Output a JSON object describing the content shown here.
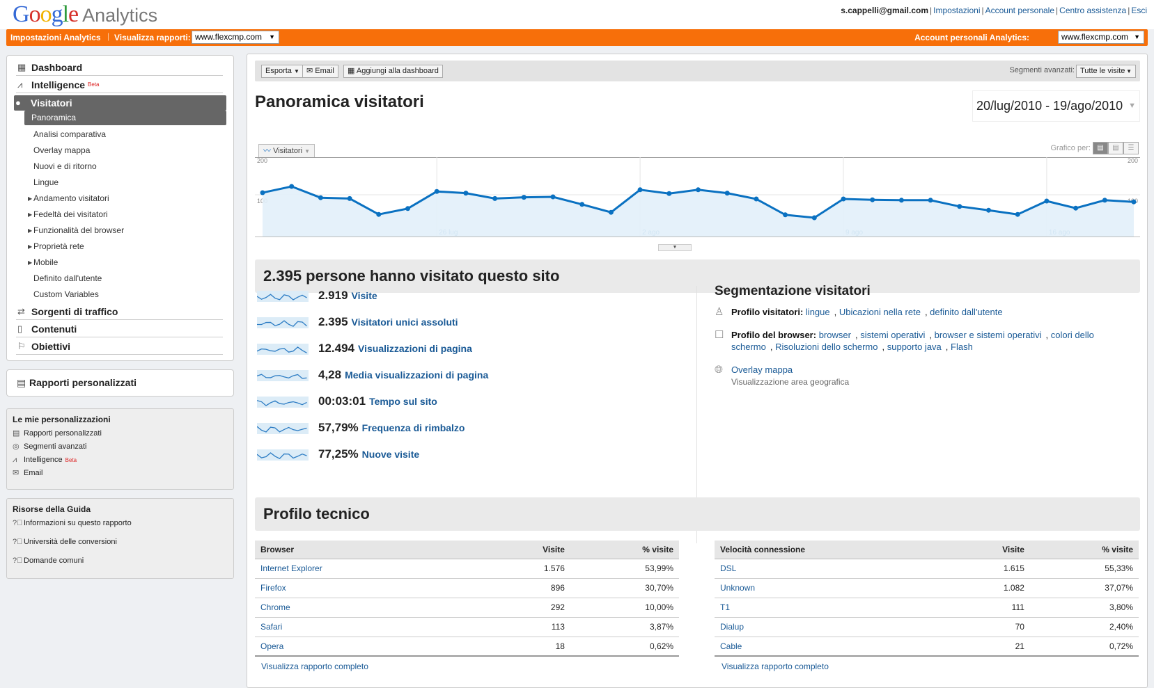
{
  "header": {
    "logo_google": "Google",
    "logo_product": "Analytics",
    "user": "s.cappelli@gmail.com",
    "links": [
      "Impostazioni",
      "Account personale",
      "Centro assistenza",
      "Esci"
    ]
  },
  "orangebar": {
    "settings": "Impostazioni Analytics",
    "view_reports_label": "Visualizza rapporti:",
    "view_reports_value": "www.flexcmp.com",
    "accounts_label": "Account personali Analytics:",
    "accounts_value": "www.flexcmp.com"
  },
  "sidebar": {
    "dashboard": "Dashboard",
    "intelligence": "Intelligence",
    "beta": "Beta",
    "visitors": "Visitatori",
    "sub": [
      {
        "label": "Panoramica",
        "active": true
      },
      {
        "label": "Analisi comparativa"
      },
      {
        "label": "Overlay mappa"
      },
      {
        "label": "Nuovi e di ritorno"
      },
      {
        "label": "Lingue"
      },
      {
        "label": "Andamento visitatori",
        "expand": true
      },
      {
        "label": "Fedeltà dei visitatori",
        "expand": true
      },
      {
        "label": "Funzionalità del browser",
        "expand": true
      },
      {
        "label": "Proprietà rete",
        "expand": true
      },
      {
        "label": "Mobile",
        "expand": true
      },
      {
        "label": "Definito dall'utente"
      },
      {
        "label": "Custom Variables"
      }
    ],
    "traffic": "Sorgenti di traffico",
    "content": "Contenuti",
    "goals": "Obiettivi",
    "custom_reports": "Rapporti personalizzati"
  },
  "personal": {
    "title": "Le mie personalizzazioni",
    "items": [
      "Rapporti personalizzati",
      "Segmenti avanzati",
      "Intelligence",
      "Email"
    ],
    "beta": "Beta"
  },
  "help": {
    "title": "Risorse della Guida",
    "items": [
      "Informazioni su questo rapporto",
      "Università delle conversioni",
      "Domande comuni"
    ]
  },
  "toolbar": {
    "export": "Esporta",
    "email": "Email",
    "add_dashboard": "Aggiungi alla dashboard",
    "segments_label": "Segmenti avanzati:",
    "segments_value": "Tutte le visite"
  },
  "page_title": "Panoramica visitatori",
  "date_range": "20/lug/2010 - 19/ago/2010",
  "chart_tab": "Visitatori",
  "graph_by": "Grafico per:",
  "chart_data": {
    "type": "area",
    "series": [
      {
        "name": "Visitatori",
        "values": [
          105,
          120,
          93,
          91,
          53,
          67,
          108,
          104,
          91,
          94,
          95,
          77,
          58,
          112,
          103,
          112,
          104,
          90,
          52,
          45,
          90,
          88,
          87,
          87,
          72,
          63,
          53,
          85,
          68,
          87,
          83
        ]
      }
    ],
    "ylim": [
      0,
      200
    ],
    "yticks_left": [
      "200",
      "100"
    ],
    "yticks_right": [
      "200",
      "100"
    ],
    "xtick_labels": [
      "26 lug",
      "2 ago",
      "9 ago",
      "16 ago"
    ],
    "xtick_index": [
      6,
      13,
      20,
      27
    ],
    "color": "#0a71c1",
    "fill": "#e2f0f9",
    "grid": true
  },
  "summary": "2.395 persone hanno visitato questo sito",
  "metrics": [
    {
      "value": "2.919",
      "label": "Visite"
    },
    {
      "value": "2.395",
      "label": "Visitatori unici assoluti"
    },
    {
      "value": "12.494",
      "label": "Visualizzazioni di pagina"
    },
    {
      "value": "4,28",
      "label": "Media visualizzazioni di pagina"
    },
    {
      "value": "00:03:01",
      "label": "Tempo sul sito"
    },
    {
      "value": "57,79%",
      "label": "Frequenza di rimbalzo"
    },
    {
      "value": "77,25%",
      "label": "Nuove visite"
    }
  ],
  "segmentation": {
    "title": "Segmentazione visitatori",
    "visitor_profile": "Profilo visitatori:",
    "visitor_links": [
      "lingue",
      "Ubicazioni nella rete",
      "definito dall'utente"
    ],
    "browser_profile": "Profilo del browser:",
    "browser_links": [
      "browser",
      "sistemi operativi",
      "browser e sistemi operativi",
      "colori dello schermo",
      "Risoluzioni dello schermo",
      "supporto java",
      "Flash"
    ],
    "overlay": "Overlay mappa",
    "overlay_desc": "Visualizzazione area geografica"
  },
  "tech_title": "Profilo tecnico",
  "browser_table": {
    "headers": [
      "Browser",
      "Visite",
      "% visite"
    ],
    "rows": [
      [
        "Internet Explorer",
        "1.576",
        "53,99%"
      ],
      [
        "Firefox",
        "896",
        "30,70%"
      ],
      [
        "Chrome",
        "292",
        "10,00%"
      ],
      [
        "Safari",
        "113",
        "3,87%"
      ],
      [
        "Opera",
        "18",
        "0,62%"
      ]
    ]
  },
  "conn_table": {
    "headers": [
      "Velocità connessione",
      "Visite",
      "% visite"
    ],
    "rows": [
      [
        "DSL",
        "1.615",
        "55,33%"
      ],
      [
        "Unknown",
        "1.082",
        "37,07%"
      ],
      [
        "T1",
        "111",
        "3,80%"
      ],
      [
        "Dialup",
        "70",
        "2,40%"
      ],
      [
        "Cable",
        "21",
        "0,72%"
      ]
    ]
  },
  "full_report": "Visualizza rapporto completo"
}
